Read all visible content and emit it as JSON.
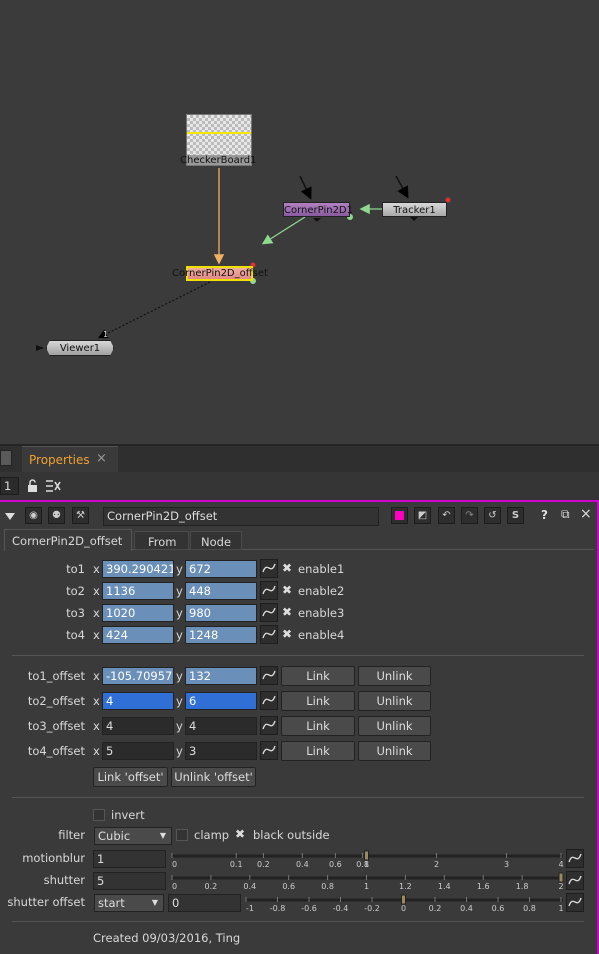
{
  "nodes": {
    "checkerboard": "CheckerBoard1",
    "cornerpin2d": "CornerPin2D1",
    "tracker": "Tracker1",
    "cornerpin_offset": "CornerPin2D_offset",
    "viewer": "Viewer1",
    "viewer_input_index": "1"
  },
  "tabs": {
    "properties": "Properties",
    "close": "×",
    "number": "1"
  },
  "panel": {
    "node_name": "CornerPin2D_offset",
    "tabs": [
      "CornerPin2D_offset",
      "From",
      "Node"
    ],
    "to_rows": [
      {
        "label": "to1",
        "x": "390.290421",
        "y": "672",
        "enable": "enable1"
      },
      {
        "label": "to2",
        "x": "1136",
        "y": "448",
        "enable": "enable2"
      },
      {
        "label": "to3",
        "x": "1020",
        "y": "980",
        "enable": "enable3"
      },
      {
        "label": "to4",
        "x": "424",
        "y": "1248",
        "enable": "enable4"
      }
    ],
    "offset_rows": [
      {
        "label": "to1_offset",
        "x": "-105.70957",
        "y": "132",
        "link": "Link",
        "unlink": "Unlink"
      },
      {
        "label": "to2_offset",
        "x": "4",
        "y": "6",
        "link": "Link",
        "unlink": "Unlink"
      },
      {
        "label": "to3_offset",
        "x": "4",
        "y": "4",
        "link": "Link",
        "unlink": "Unlink"
      },
      {
        "label": "to4_offset",
        "x": "5",
        "y": "3",
        "link": "Link",
        "unlink": "Unlink"
      }
    ],
    "xy": {
      "x": "x",
      "y": "y"
    },
    "link_offset": "Link 'offset'",
    "unlink_offset": "Unlink 'offset'",
    "invert": "invert",
    "filter_label": "filter",
    "filter_value": "Cubic",
    "clamp": "clamp",
    "black_outside": "black outside",
    "motionblur_label": "motionblur",
    "motionblur_value": "1",
    "motionblur_ticks": [
      "0",
      "0.1",
      "0.2",
      "0.4",
      "0.6",
      "0.8",
      "1",
      "2",
      "3",
      "4"
    ],
    "shutter_label": "shutter",
    "shutter_value": "5",
    "shutter_ticks": [
      "0",
      "0.2",
      "0.4",
      "0.6",
      "0.8",
      "1",
      "1.2",
      "1.4",
      "1.6",
      "1.8",
      "2"
    ],
    "shutter_offset_label": "shutter offset",
    "shutter_offset_mode": "start",
    "shutter_offset_value": "0",
    "shutter_offset_ticks": [
      "-1",
      "-0.8",
      "-0.6",
      "-0.4",
      "-0.2",
      "0",
      "0.2",
      "0.4",
      "0.6",
      "0.8",
      "1"
    ],
    "created": "Created 09/03/2016, Ting"
  },
  "colors": {
    "accent": "#d000d0",
    "tab_title": "#f0a030",
    "field_blue": "#6a8fb8",
    "field_selected": "#2f6fd6"
  }
}
